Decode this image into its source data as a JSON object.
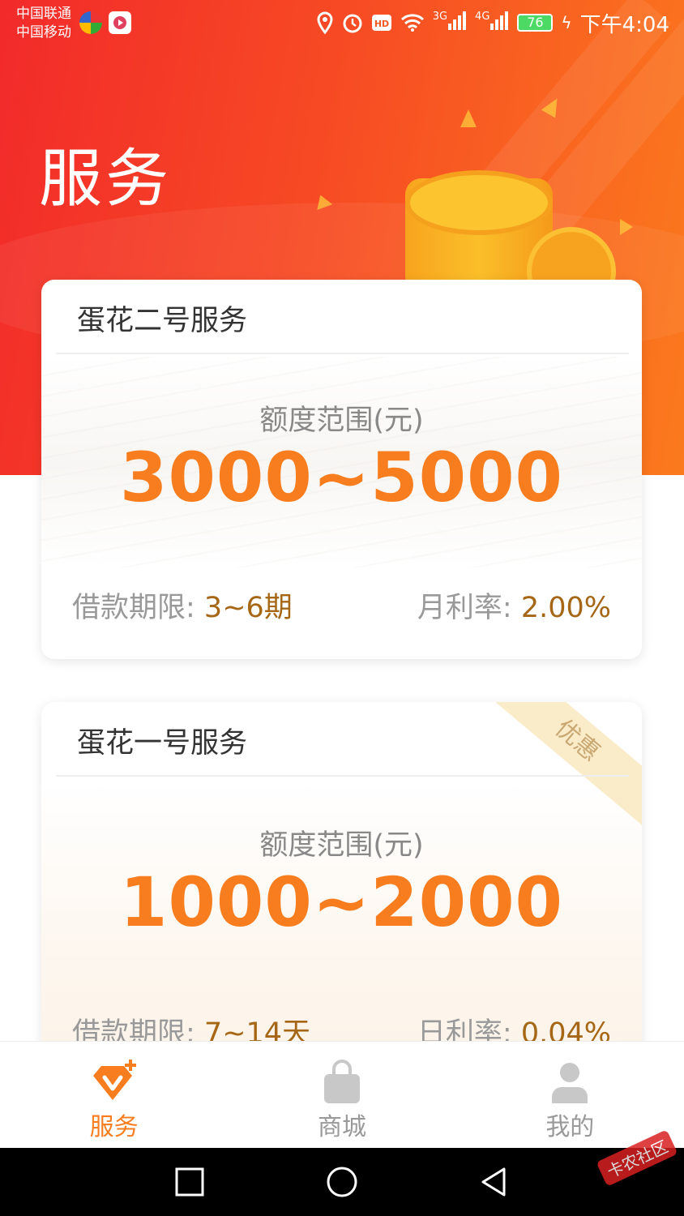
{
  "status_bar": {
    "carrier_1": "中国联通",
    "carrier_2": "中国移动",
    "network_1": "3G",
    "network_2": "4G",
    "battery": "76",
    "time": "下午4:04"
  },
  "header": {
    "title": "服务"
  },
  "cards": [
    {
      "name": "蛋花二号服务",
      "range_label": "额度范围(元)",
      "range_value": "3000~5000",
      "term_label": "借款期限: ",
      "term_value": "3~6期",
      "rate_label": "月利率: ",
      "rate_value": "2.00%"
    },
    {
      "name": "蛋花一号服务",
      "badge": "优惠",
      "range_label": "额度范围(元)",
      "range_value": "1000~2000",
      "term_label": "借款期限: ",
      "term_value": "7~14天",
      "rate_label": "日利率: ",
      "rate_value": "0.04%"
    }
  ],
  "tabbar": {
    "items": [
      {
        "label": "服务",
        "icon": "service-icon",
        "active": true
      },
      {
        "label": "商城",
        "icon": "shopping-bag-icon",
        "active": false
      },
      {
        "label": "我的",
        "icon": "user-icon",
        "active": false
      }
    ]
  },
  "colors": {
    "accent": "#f87d1f",
    "hero_start": "#f22a2a",
    "hero_end": "#fb7a1d",
    "term_value": "#a56615",
    "badge_bg": "#fbecc9"
  },
  "watermark": "卡农社区"
}
